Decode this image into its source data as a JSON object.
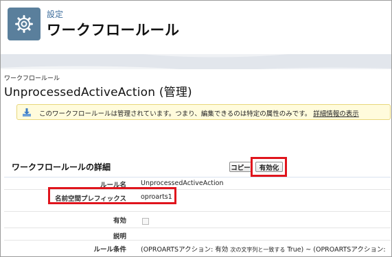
{
  "header": {
    "subtitle": "設定",
    "title": "ワークフロールール",
    "icon": "gear-icon"
  },
  "breadcrumb": "ワークフロールール",
  "record_title": "UnprocessedActiveAction (管理)",
  "info_banner": {
    "icon": "download-arrow-icon",
    "text": "このワークフロールールは管理されています。つまり、編集できるのは特定の属性のみです。",
    "link": "詳細情報の表示"
  },
  "detail": {
    "section_title": "ワークフロールールの詳細",
    "copy_label": "コピー",
    "enable_label": "有効化",
    "fields": {
      "rule_name": {
        "label": "ルール名",
        "value": "UnprocessedActiveAction"
      },
      "namespace_prefix": {
        "label": "名前空間プレフィックス",
        "value": "oproarts1"
      },
      "active": {
        "label": "有効",
        "checked": false
      },
      "description": {
        "label": "説明",
        "value": ""
      },
      "criteria": {
        "label": "ルール条件",
        "value_pre": "(OPROARTSアクション: 有効",
        "value_small": "次の文字列と一致する",
        "value_post": "True) ~ (OPROARTSアクション:"
      }
    }
  },
  "colors": {
    "header_icon_bg": "#5a7f9c",
    "subtitle": "#3e6e9c",
    "highlight": "#e0141c",
    "banner_bg": "#fffbdc"
  }
}
